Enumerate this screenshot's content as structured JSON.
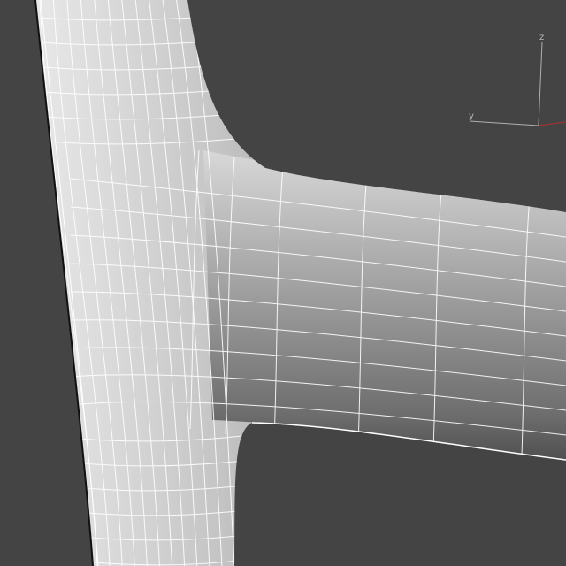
{
  "viewport": {
    "background_color": "#444444",
    "mesh_color": "#a8a8a8",
    "wire_color": "#ffffff"
  },
  "gizmo": {
    "x_label": "",
    "y_label": "y",
    "z_label": "z",
    "x_color": "#b03030",
    "y_color": "#b0b0b0",
    "z_color": "#b0b0b0"
  }
}
